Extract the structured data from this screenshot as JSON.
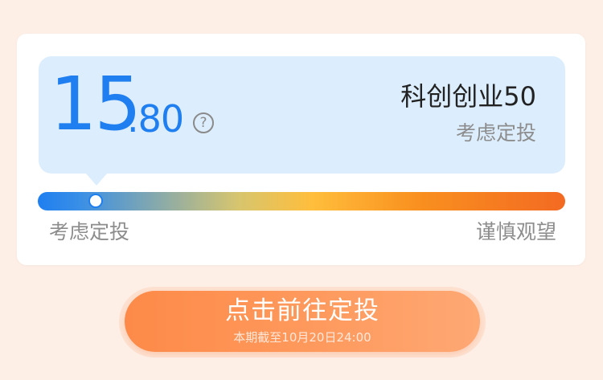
{
  "valuation": {
    "value_int": "15",
    "value_dec": ".80",
    "help_glyph": "?",
    "index_name": "科创创业50",
    "status": "考虑定投"
  },
  "gauge": {
    "position": 0.11,
    "left_label": "考虑定投",
    "right_label": "谨慎观望",
    "colors": {
      "start": "#1f7ff0",
      "middle": "#ffbe3c",
      "end": "#f36a22"
    }
  },
  "cta": {
    "label": "点击前往定投",
    "sub_label": "本期截至10月20日24:00"
  },
  "icons": {
    "help": "question-circle-icon"
  }
}
